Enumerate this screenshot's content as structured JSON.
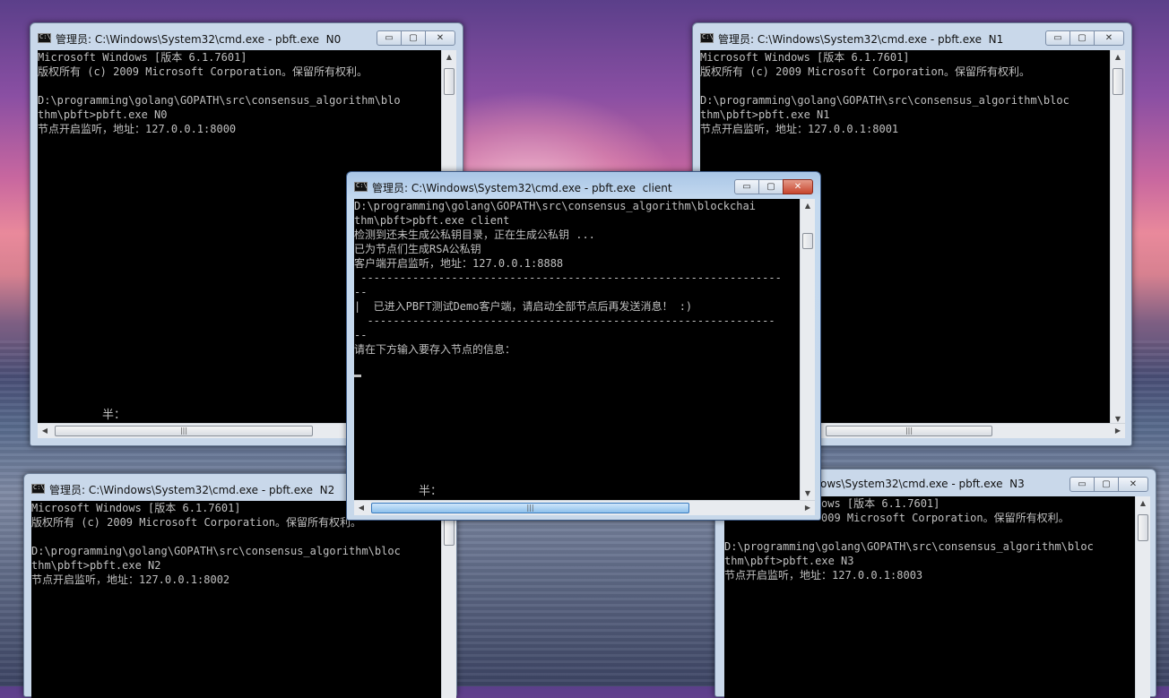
{
  "windows": {
    "n0": {
      "title": "管理员: C:\\Windows\\System32\\cmd.exe - pbft.exe  N0",
      "lines": [
        "Microsoft Windows [版本 6.1.7601]",
        "版权所有 (c) 2009 Microsoft Corporation。保留所有权利。",
        "",
        "D:\\programming\\golang\\GOPATH\\src\\consensus_algorithm\\blo",
        "thm\\pbft>pbft.exe N0",
        "节点开启监听，地址：127.0.0.1:8000"
      ],
      "ime": "半："
    },
    "n1": {
      "title": "管理员: C:\\Windows\\System32\\cmd.exe - pbft.exe  N1",
      "lines": [
        "Microsoft Windows [版本 6.1.7601]",
        "版权所有 (c) 2009 Microsoft Corporation。保留所有权利。",
        "",
        "D:\\programming\\golang\\GOPATH\\src\\consensus_algorithm\\bloc",
        "thm\\pbft>pbft.exe N1",
        "节点开启监听，地址：127.0.0.1:8001"
      ]
    },
    "n2": {
      "title": "管理员: C:\\Windows\\System32\\cmd.exe - pbft.exe  N2",
      "lines": [
        "Microsoft Windows [版本 6.1.7601]",
        "版权所有 (c) 2009 Microsoft Corporation。保留所有权利。",
        "",
        "D:\\programming\\golang\\GOPATH\\src\\consensus_algorithm\\bloc",
        "thm\\pbft>pbft.exe N2",
        "节点开启监听，地址：127.0.0.1:8002"
      ]
    },
    "n3": {
      "title": "ows\\System32\\cmd.exe - pbft.exe  N3",
      "lines": [
        "ows [版本 6.1.7601]",
        "009 Microsoft Corporation。保留所有权利。",
        "",
        "D:\\programming\\golang\\GOPATH\\src\\consensus_algorithm\\bloc",
        "thm\\pbft>pbft.exe N3",
        "节点开启监听，地址：127.0.0.1:8003"
      ]
    },
    "client": {
      "title": "管理员: C:\\Windows\\System32\\cmd.exe - pbft.exe  client",
      "lines": [
        "D:\\programming\\golang\\GOPATH\\src\\consensus_algorithm\\blockchai",
        "thm\\pbft>pbft.exe client",
        "检测到还未生成公私钥目录，正在生成公私钥 ...",
        "已为节点们生成RSA公私钥",
        "客户端开启监听，地址：127.0.0.1:8888",
        " -----------------------------------------------------------------",
        "--",
        "|  已进入PBFT测试Demo客户端，请启动全部节点后再发送消息！ :)",
        "  ---------------------------------------------------------------",
        "--",
        "请在下方输入要存入节点的信息："
      ],
      "ime": "半："
    }
  },
  "controls": {
    "minimize": "▭",
    "maximize": "▢",
    "close": "✕"
  },
  "scroll": {
    "up": "▲",
    "down": "▼",
    "left": "◀",
    "right": "▶",
    "grip": "|||"
  }
}
